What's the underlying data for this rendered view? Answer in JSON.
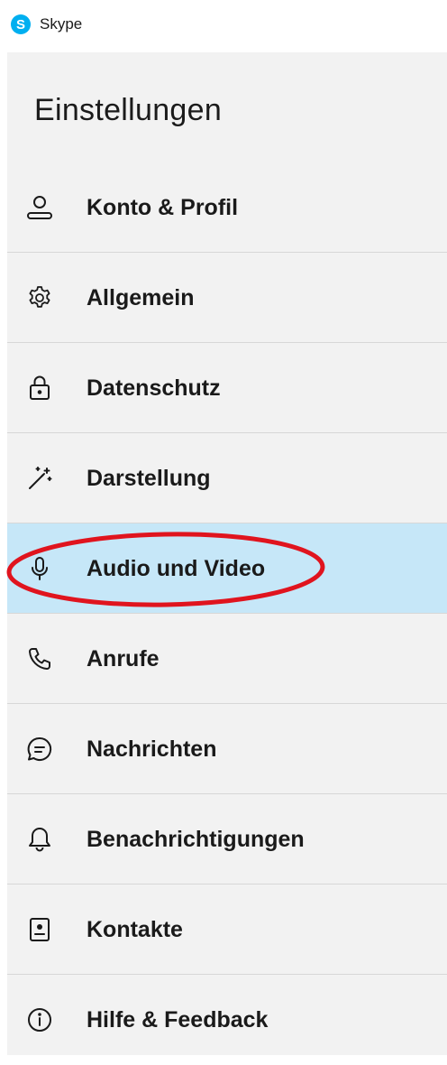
{
  "window": {
    "logo_letter": "S",
    "title": "Skype"
  },
  "settings": {
    "heading": "Einstellungen",
    "items": [
      {
        "label": "Konto & Profil",
        "icon": "person-icon"
      },
      {
        "label": "Allgemein",
        "icon": "gear-icon"
      },
      {
        "label": "Datenschutz",
        "icon": "lock-icon"
      },
      {
        "label": "Darstellung",
        "icon": "magic-wand-icon"
      },
      {
        "label": "Audio und Video",
        "icon": "microphone-icon",
        "selected": true
      },
      {
        "label": "Anrufe",
        "icon": "phone-icon"
      },
      {
        "label": "Nachrichten",
        "icon": "chat-bubble-icon"
      },
      {
        "label": "Benachrichtigungen",
        "icon": "bell-icon"
      },
      {
        "label": "Kontakte",
        "icon": "contact-card-icon"
      },
      {
        "label": "Hilfe & Feedback",
        "icon": "info-icon"
      }
    ]
  },
  "colors": {
    "brand": "#00aff0",
    "panel_background": "#f2f2f2",
    "selected_background": "#c6e7f8",
    "annotation": "#e0141e",
    "divider": "#d7d7d7"
  }
}
